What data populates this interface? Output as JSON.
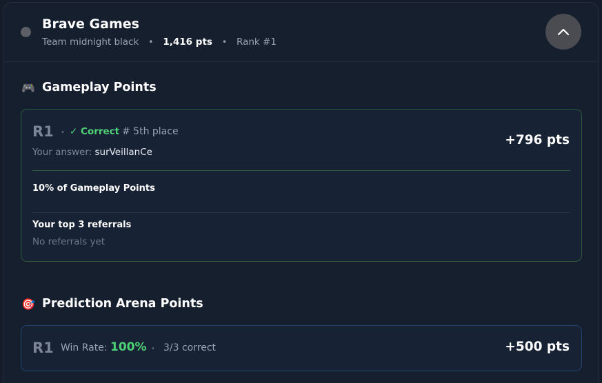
{
  "team": {
    "name": "Brave Games",
    "subtitle": "Team midnight black",
    "points": "1,416 pts",
    "rank": "Rank #1",
    "separator": "•"
  },
  "gameplay": {
    "icon": "🎮",
    "title": "Gameplay Points",
    "card": {
      "round": "R1",
      "separator": "•",
      "status": "✓ Correct",
      "place": "# 5th place",
      "answer_label": "Your answer:",
      "answer_value": "surVeillanCe",
      "points": "+796 pts",
      "referral_share_label": "10% of Gameplay Points",
      "referrals_title": "Your top 3 referrals",
      "referrals_empty": "No referrals yet"
    }
  },
  "prediction": {
    "icon": "🎯",
    "title": "Prediction Arena Points",
    "card": {
      "round": "R1",
      "win_rate_label": "Win Rate:",
      "win_rate_value": "100%",
      "separator": "•",
      "correct_count": "3/3 correct",
      "points": "+500 pts"
    }
  },
  "colors": {
    "background": "#141c2a",
    "panel": "#161f2e",
    "card": "#172234",
    "correct_green": "#4fd277",
    "gameplay_border": "#2c5b3c",
    "prediction_border": "#24426e"
  }
}
